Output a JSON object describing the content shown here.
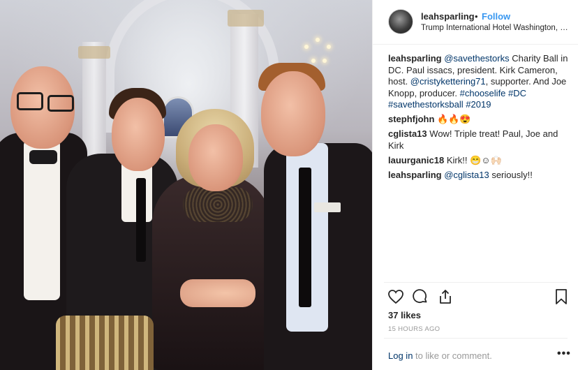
{
  "post": {
    "username": "leahsparling",
    "separator": "•",
    "follow_label": "Follow",
    "location": "Trump International Hotel Washington, D.C.",
    "photo_alt": "Four people posing at a charity ball",
    "comments": [
      {
        "user": "leahsparling",
        "segments": [
          {
            "text": "@savethestorks",
            "tag": true
          },
          {
            "text": " Charity Ball in DC. Paul issacs, president. Kirk Cameron, host. ",
            "tag": false
          },
          {
            "text": "@cristykettering71",
            "tag": true
          },
          {
            "text": ", supporter. And Joe Knopp, producer. ",
            "tag": false
          },
          {
            "text": "#chooselife",
            "tag": true
          },
          {
            "text": " ",
            "tag": false
          },
          {
            "text": "#DC",
            "tag": true
          },
          {
            "text": " ",
            "tag": false
          },
          {
            "text": "#savethestorksball",
            "tag": true
          },
          {
            "text": " ",
            "tag": false
          },
          {
            "text": "#2019",
            "tag": true
          }
        ]
      },
      {
        "user": "stephfjohn",
        "segments": [
          {
            "text": "🔥🔥😍",
            "tag": false
          }
        ]
      },
      {
        "user": "cglista13",
        "segments": [
          {
            "text": "Wow! Triple treat! Paul, Joe and Kirk",
            "tag": false
          }
        ]
      },
      {
        "user": "lauurganic18",
        "segments": [
          {
            "text": "Kirk!! 😁☺🙌🏻",
            "tag": false
          }
        ]
      },
      {
        "user": "leahsparling",
        "segments": [
          {
            "text": "@cglista13",
            "tag": true
          },
          {
            "text": " seriously!!",
            "tag": false
          }
        ]
      }
    ],
    "likes": "37 likes",
    "time": "15 HOURS AGO",
    "login_link": "Log in",
    "login_rest": " to like or comment.",
    "more_label": "•••",
    "icons": [
      "heart-icon",
      "comment-icon",
      "share-icon",
      "bookmark-icon"
    ],
    "colors": {
      "link": "#003569",
      "follow": "#3897f0",
      "muted": "#999999",
      "border": "#efefef"
    }
  }
}
